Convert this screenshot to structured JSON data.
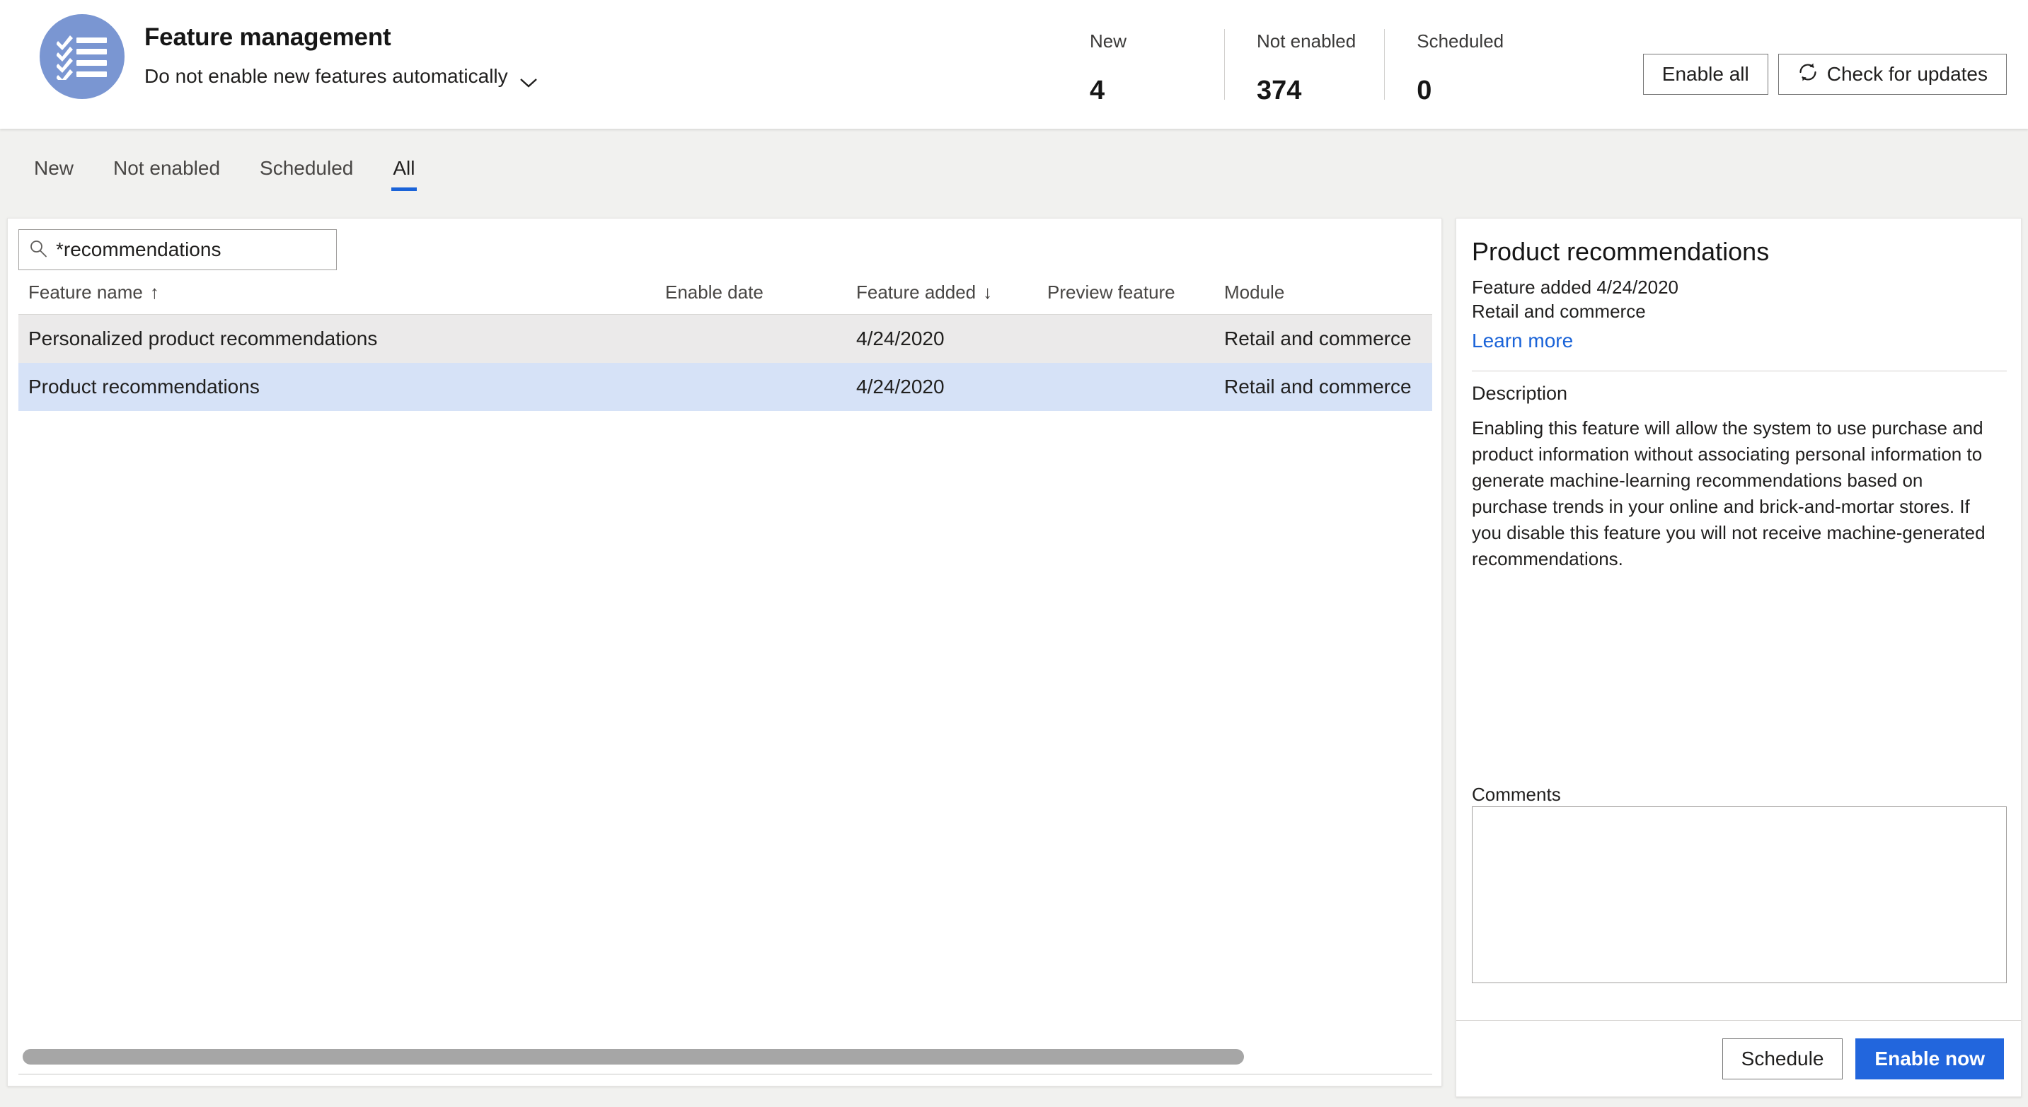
{
  "header": {
    "icon": "checklist-icon",
    "title": "Feature management",
    "subtitle": "Do not enable new features automatically",
    "subtitle_chevron": "chevron-down-icon",
    "stats": [
      {
        "label": "New",
        "value": "4"
      },
      {
        "label": "Not enabled",
        "value": "374"
      },
      {
        "label": "Scheduled",
        "value": "0"
      }
    ],
    "buttons": [
      {
        "label": "Enable all",
        "icon": null
      },
      {
        "label": "Check for updates",
        "icon": "refresh-icon"
      }
    ]
  },
  "tabs": [
    {
      "label": "New",
      "active": false
    },
    {
      "label": "Not enabled",
      "active": false
    },
    {
      "label": "Scheduled",
      "active": false
    },
    {
      "label": "All",
      "active": true
    }
  ],
  "list": {
    "search": {
      "value": "*recommendations",
      "placeholder": "",
      "icon": "search-icon"
    },
    "columns": [
      {
        "label": "Feature name",
        "sort": "↑"
      },
      {
        "label": "Enable date",
        "sort": ""
      },
      {
        "label": "Feature added",
        "sort": "↓"
      },
      {
        "label": "Preview feature",
        "sort": ""
      },
      {
        "label": "Module",
        "sort": ""
      }
    ],
    "rows": [
      {
        "feature_name": "Personalized product recommendations",
        "enable_date": "",
        "feature_added": "4/24/2020",
        "preview_feature": "",
        "module": "Retail and commerce",
        "state": "hover"
      },
      {
        "feature_name": "Product recommendations",
        "enable_date": "",
        "feature_added": "4/24/2020",
        "preview_feature": "",
        "module": "Retail and commerce",
        "state": "selected"
      }
    ]
  },
  "detail": {
    "title": "Product recommendations",
    "feature_added": "Feature added 4/24/2020",
    "module": "Retail and commerce",
    "learn_more": "Learn more",
    "description_label": "Description",
    "description": "Enabling this feature will allow the system to use purchase and product information without associating personal information to generate machine-learning recommendations based on purchase trends in your online and brick-and-mortar stores. If you disable this feature you will not receive machine-generated recommendations.",
    "comments_label": "Comments",
    "comments_value": "",
    "buttons": {
      "schedule": "Schedule",
      "enable_now": "Enable now"
    }
  },
  "colors": {
    "accent": "#1a63d8",
    "primary_button": "#2266dd",
    "icon_badge": "#7a96d2",
    "selected_row": "#d6e2f7",
    "hover_row": "#ebeaea",
    "page_bg": "#f1f1ef"
  }
}
